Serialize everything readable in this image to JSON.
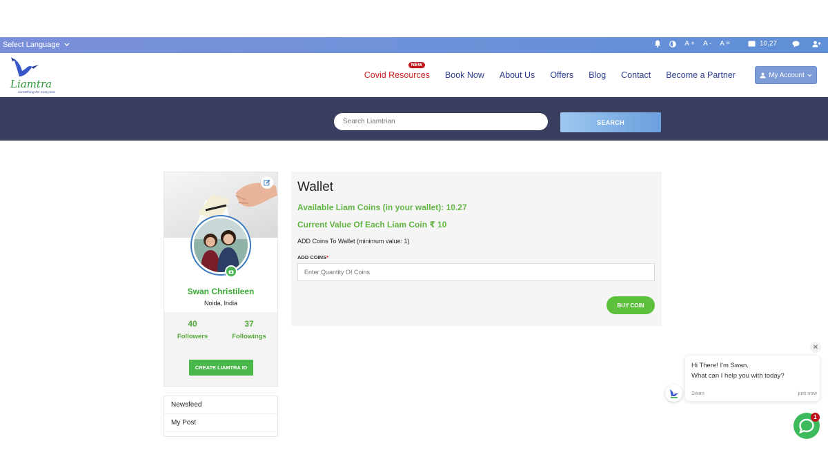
{
  "topbar": {
    "language_label": "Select Language",
    "font_increase": "A +",
    "font_decrease": "A -",
    "font_reset": "A =",
    "wallet_balance": "10.27"
  },
  "nav": {
    "logo_text": "Liamtra",
    "logo_tagline": "something for everyone",
    "items": [
      {
        "label": "Covid Resources",
        "badge": "NEW"
      },
      {
        "label": "Book Now"
      },
      {
        "label": "About Us"
      },
      {
        "label": "Offers"
      },
      {
        "label": "Blog"
      },
      {
        "label": "Contact"
      },
      {
        "label": "Become a Partner"
      }
    ],
    "account_label": "My Account"
  },
  "search": {
    "placeholder": "Search Liamtrian",
    "button_label": "SEARCH"
  },
  "profile": {
    "name": "Swan Christileen",
    "location": "Noida, India",
    "followers_count": "40",
    "followers_label": "Followers",
    "followings_count": "37",
    "followings_label": "Followings",
    "create_button": "CREATE LIAMTRA ID"
  },
  "sidelinks": [
    "Newsfeed",
    "My Post"
  ],
  "wallet": {
    "title": "Wallet",
    "available": "Available Liam Coins (in your wallet): 10.27",
    "current_value": "Current Value Of Each Liam Coin ₹ 10",
    "add_note": "ADD Coins To Wallet (minimum value: 1)",
    "add_coins_label": "ADD COINS",
    "required_mark": "*",
    "qty_placeholder": "Enter Quantity Of Coins",
    "buy_button": "BUY COIN"
  },
  "chat": {
    "message_line1": "Hi There! I'm Swan.",
    "message_line2": "What can I help you with today?",
    "sender": "Swan",
    "time": "just now",
    "badge_count": "1",
    "close_symbol": "✕"
  },
  "colors": {
    "topbar": "#6e92d9",
    "band": "#3b3f5f",
    "green": "#62b544",
    "nav_link": "#2b3d8f",
    "covid_link": "#cc1f1f"
  }
}
